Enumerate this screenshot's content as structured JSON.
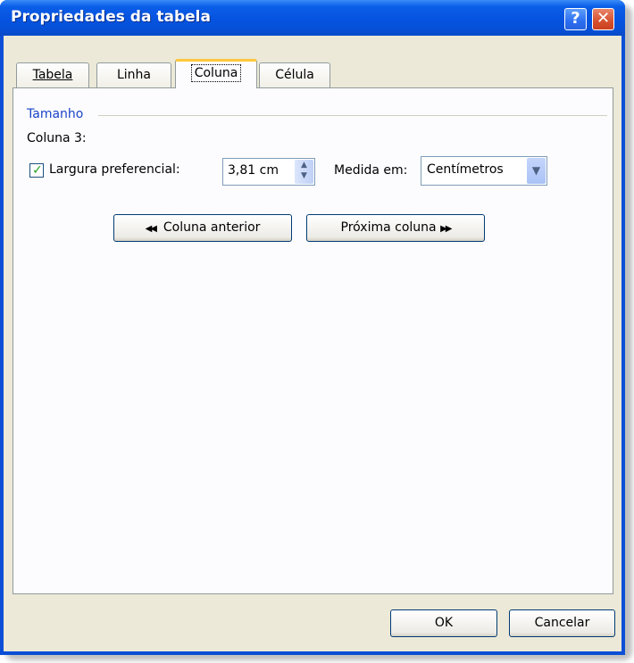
{
  "window": {
    "title": "Propriedades da tabela",
    "help_icon": "help-icon",
    "close_icon": "close-icon"
  },
  "tabs": [
    {
      "label": "Tabela",
      "active": false
    },
    {
      "label": "Linha",
      "active": false
    },
    {
      "label": "Coluna",
      "active": true
    },
    {
      "label": "Célula",
      "active": false
    }
  ],
  "panel": {
    "group_label": "Tamanho",
    "column_label": "Coluna 3:",
    "preferred_width": {
      "checked": true,
      "label": "Largura preferencial:",
      "value": "3,81 cm"
    },
    "measure": {
      "label": "Medida em:",
      "selected": "Centímetros"
    },
    "prev_button": "Coluna anterior",
    "next_button": "Próxima coluna"
  },
  "footer": {
    "ok_label": "OK",
    "cancel_label": "Cancelar"
  },
  "colors": {
    "titlebar": "#0553e0",
    "dialog_bg": "#ece9d8",
    "active_tab_accent": "#ffc83c",
    "group_label": "#1a44c8"
  }
}
